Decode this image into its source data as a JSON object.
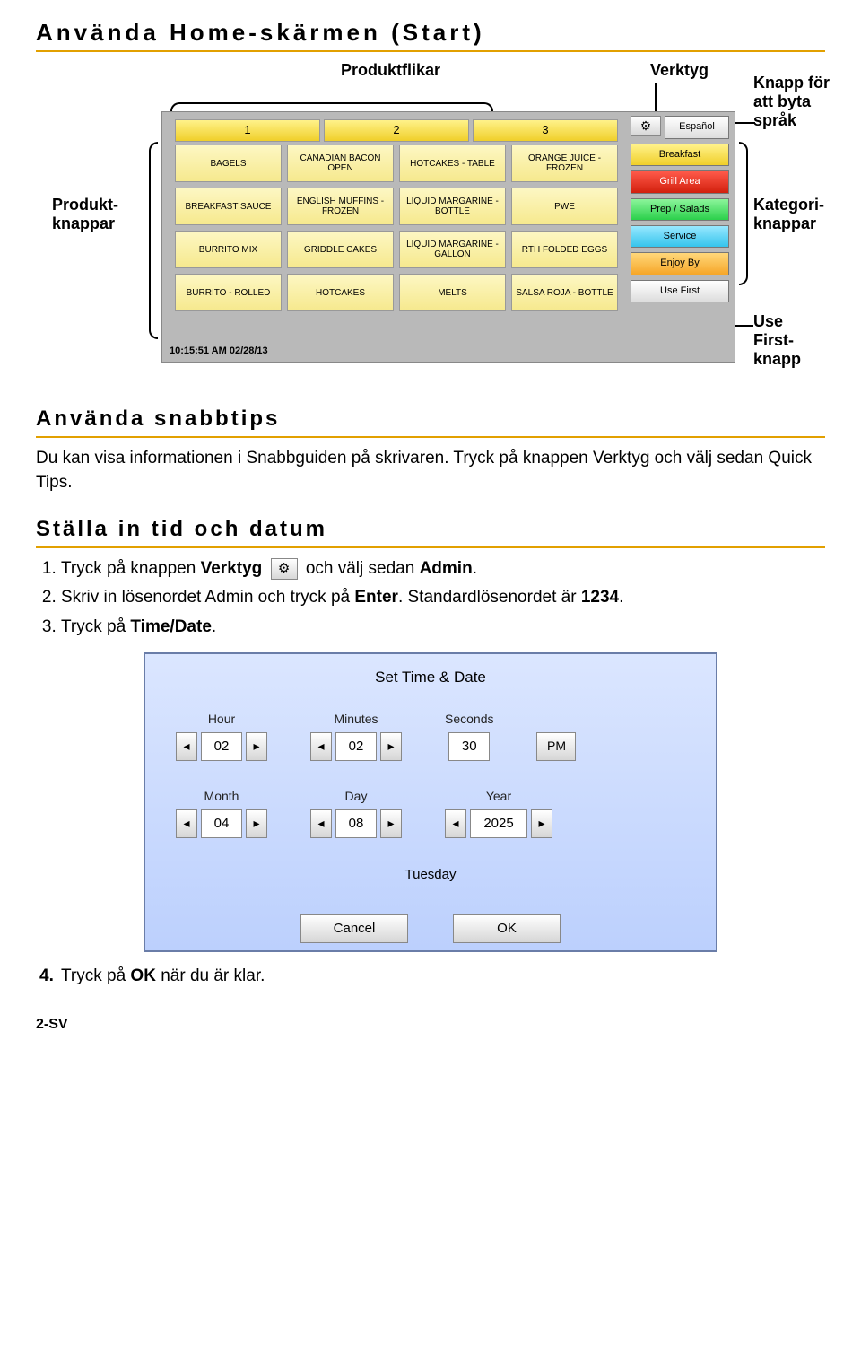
{
  "headings": {
    "h1": "Använda Home-skärmen (Start)",
    "h2": "Använda snabbtips",
    "h3": "Ställa in tid och datum"
  },
  "callouts": {
    "product_tabs": "Produktflikar",
    "tools": "Verktyg",
    "lang_button_line1": "Knapp för",
    "lang_button_line2": "att byta",
    "lang_button_line3": "språk",
    "product_buttons_line1": "Produkt-",
    "product_buttons_line2": "knappar",
    "category_buttons_line1": "Kategori-",
    "category_buttons_line2": "knappar",
    "usefirst_line1": "Use First-",
    "usefirst_line2": "knapp"
  },
  "screen": {
    "tabs": [
      "1",
      "2",
      "3"
    ],
    "products": [
      "BAGELS",
      "CANADIAN BACON OPEN",
      "HOTCAKES - TABLE",
      "ORANGE JUICE - FROZEN",
      "BREAKFAST SAUCE",
      "ENGLISH MUFFINS - FROZEN",
      "LIQUID MARGARINE - BOTTLE",
      "PWE",
      "BURRITO MIX",
      "GRIDDLE CAKES",
      "LIQUID MARGARINE - GALLON",
      "RTH FOLDED EGGS",
      "BURRITO - ROLLED",
      "HOTCAKES",
      "MELTS",
      "SALSA ROJA - BOTTLE"
    ],
    "lang_button": "Español",
    "categories": {
      "breakfast": "Breakfast",
      "grill": "Grill Area",
      "prep": "Prep / Salads",
      "service": "Service",
      "enjoy": "Enjoy By"
    },
    "use_first": "Use First",
    "timestamp": "10:15:51 AM   02/28/13",
    "tool_glyph": "⚙"
  },
  "text": {
    "snabbtips_para": "Du kan visa informationen i Snabbguiden på skrivaren. Tryck på knappen Verktyg och välj sedan Quick Tips.",
    "step1_pre": "Tryck på knappen ",
    "step1_bold": "Verktyg",
    "step1_post": " och välj sedan ",
    "step1_bold2": "Admin",
    "step2_pre": "Skriv in lösenordet Admin och tryck på ",
    "step2_bold": "Enter",
    "step2_post": ". Standardlösenordet är ",
    "step2_bold2": "1234",
    "step3_pre": "Tryck på ",
    "step3_bold": "Time/Date",
    "step4_pre": "Tryck på ",
    "step4_bold": "OK",
    "step4_post": " när du är klar.",
    "period": "."
  },
  "timedate": {
    "title": "Set Time & Date",
    "hour_lbl": "Hour",
    "hour": "02",
    "min_lbl": "Minutes",
    "min": "02",
    "sec_lbl": "Seconds",
    "sec": "30",
    "ampm": "PM",
    "month_lbl": "Month",
    "month": "04",
    "day_lbl": "Day",
    "day": "08",
    "year_lbl": "Year",
    "year": "2025",
    "weekday": "Tuesday",
    "cancel": "Cancel",
    "ok": "OK",
    "left": "◂",
    "right": "▸"
  },
  "pageno": "2-SV"
}
